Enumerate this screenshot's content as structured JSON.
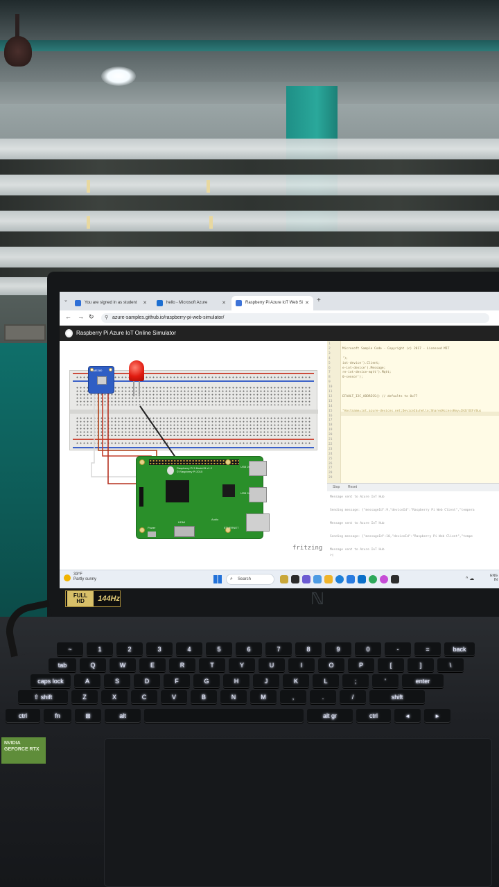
{
  "browser": {
    "tabs": [
      {
        "label": "You are signed in as student"
      },
      {
        "label": "hello - Microsoft Azure"
      },
      {
        "label": "Raspberry Pi Azure IoT Web Si"
      }
    ],
    "new_tab": "+",
    "url": "azure-samples.github.io/raspberry-pi-web-simulator/"
  },
  "app": {
    "title": "Raspberry Pi Azure IoT Online Simulator",
    "fritzing_label": "fritzing",
    "pi_model": "Raspberry Pi 3 Model B v1.2",
    "pi_copyright": "© Raspberry Pi 2015",
    "sensor_label": "BME280",
    "port_labels": {
      "hdmi": "HDMI",
      "power": "Power",
      "audio": "Audio",
      "usb_a": "USB 2x",
      "usb_b": "USB 2x",
      "eth": "ETHERNET"
    }
  },
  "editor": {
    "line_numbers": [
      "1",
      "2",
      "3",
      "4",
      "5",
      "6",
      "7",
      "8",
      "9",
      "10",
      "11",
      "12",
      "13",
      "14",
      "15",
      "16",
      "17",
      "18",
      "19",
      "20",
      "21",
      "22",
      "23",
      "24",
      "25",
      "26",
      "27",
      "28",
      "29"
    ],
    "lines": [
      {
        "n": 2,
        "text": "   Microsoft Sample Code - Copyright (c) 2017 - Licensed MIT"
      },
      {
        "n": 4,
        "text": "');"
      },
      {
        "n": 5,
        "text": "iot-device').Client;"
      },
      {
        "n": 6,
        "text": "e-iot-device').Message;"
      },
      {
        "n": 7,
        "text": "re-iot-device-mqtt').Mqtt;"
      },
      {
        "n": 8,
        "text": "0-sensor');"
      },
      {
        "n": 12,
        "text": "EFAULT_I2C_ADDRESS() // defaults to 0x77"
      },
      {
        "n": 15,
        "text": "\"Hostname=iot.azure-devices.net;DeviceId=hello;SharedAccessKey=IHZrXEFrBus"
      }
    ]
  },
  "console": {
    "tabs": [
      "Stop",
      "Reset"
    ],
    "lines": [
      "Message sent to Azure IoT Hub",
      "Sending message: {\"messageId\":9,\"deviceId\":\"Raspberry Pi Web Client\",\"tempera",
      "Message sent to Azure IoT Hub",
      "Sending message: {\"messageId\":10,\"deviceId\":\"Raspberry Pi Web Client\",\"tempe",
      "Message sent to Azure IoT Hub"
    ]
  },
  "taskbar": {
    "temp": "33°F",
    "weather": "Partly sunny",
    "search": "Search",
    "lang": "ENG",
    "region": "IN"
  },
  "laptop": {
    "badge_hd": "FULL HD",
    "badge_hz": "144Hz",
    "sticker": "NVIDIA GEFORCE RTX"
  },
  "keyboard": {
    "rows": [
      [
        "~",
        "1",
        "2",
        "3",
        "4",
        "5",
        "6",
        "7",
        "8",
        "9",
        "0",
        "-",
        "=",
        "back"
      ],
      [
        "tab",
        "Q",
        "W",
        "E",
        "R",
        "T",
        "Y",
        "U",
        "I",
        "O",
        "P",
        "[",
        "]",
        "\\"
      ],
      [
        "caps lock",
        "A",
        "S",
        "D",
        "F",
        "G",
        "H",
        "J",
        "K",
        "L",
        ";",
        "'",
        "enter"
      ],
      [
        "⇧ shift",
        "Z",
        "X",
        "C",
        "V",
        "B",
        "N",
        "M",
        ",",
        ".",
        "/",
        "shift"
      ],
      [
        "ctrl",
        "fn",
        "⊞",
        "alt",
        "",
        "alt gr",
        "ctrl",
        "◂",
        "▸"
      ]
    ]
  },
  "colors": {
    "led": "#e11b10",
    "pi_board": "#2a8f2a",
    "sensor": "#2f5ec4",
    "editor_bg": "#fffbe6"
  }
}
